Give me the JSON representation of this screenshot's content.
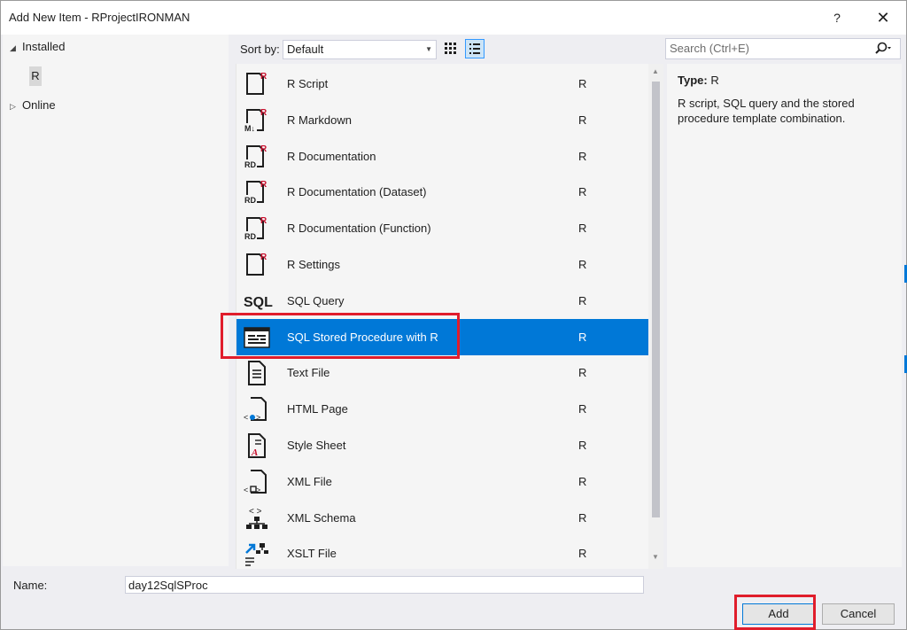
{
  "window": {
    "title": "Add New Item - RProjectIRONMAN",
    "help_label": "?",
    "close_label": "✕"
  },
  "tree": {
    "installed_label": "Installed",
    "installed_child": "R",
    "online_label": "Online"
  },
  "toolbar": {
    "sort_label": "Sort by:",
    "sort_value": "Default",
    "search_placeholder": "Search (Ctrl+E)"
  },
  "templates": [
    {
      "name": "R Script",
      "lang": "R",
      "icon": "r-script-icon"
    },
    {
      "name": "R Markdown",
      "lang": "R",
      "icon": "r-markdown-icon"
    },
    {
      "name": "R  Documentation",
      "lang": "R",
      "icon": "r-documentation-icon"
    },
    {
      "name": "R Documentation (Dataset)",
      "lang": "R",
      "icon": "r-documentation-icon"
    },
    {
      "name": "R Documentation (Function)",
      "lang": "R",
      "icon": "r-documentation-icon"
    },
    {
      "name": "R Settings",
      "lang": "R",
      "icon": "r-settings-icon"
    },
    {
      "name": "SQL Query",
      "lang": "R",
      "icon": "sql-icon"
    },
    {
      "name": "SQL Stored Procedure with R",
      "lang": "R",
      "icon": "stored-procedure-icon",
      "selected": true
    },
    {
      "name": "Text File",
      "lang": "R",
      "icon": "text-file-icon"
    },
    {
      "name": "HTML Page",
      "lang": "R",
      "icon": "html-page-icon"
    },
    {
      "name": "Style Sheet",
      "lang": "R",
      "icon": "style-sheet-icon"
    },
    {
      "name": "XML File",
      "lang": "R",
      "icon": "xml-file-icon"
    },
    {
      "name": "XML Schema",
      "lang": "R",
      "icon": "xml-schema-icon"
    },
    {
      "name": "XSLT File",
      "lang": "R",
      "icon": "xslt-file-icon"
    }
  ],
  "details": {
    "type_label": "Type:",
    "type_value": "R",
    "description": "R script, SQL query and the stored procedure template combination."
  },
  "footer": {
    "name_label": "Name:",
    "name_value": "day12SqlSProc",
    "add_label": "Add",
    "cancel_label": "Cancel"
  },
  "colors": {
    "selection": "#0078d7",
    "highlight": "#e01d2c"
  }
}
